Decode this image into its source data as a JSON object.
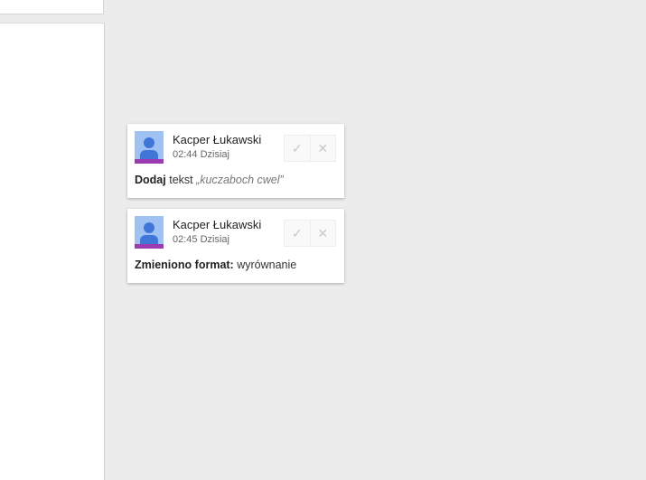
{
  "colors": {
    "canvas_background": "#ececec",
    "avatar_background": "#9fc2f3",
    "avatar_figure": "#3f76d8",
    "user_color": "#9c3ab2"
  },
  "suggestions": [
    {
      "author": "Kacper Łukawski",
      "time": "02:44 Dzisiaj",
      "action": "Dodaj",
      "detail": "tekst",
      "quoted_text": "„kuczaboch cwel”",
      "accept_icon": "checkmark-icon",
      "reject_icon": "close-icon"
    },
    {
      "author": "Kacper Łukawski",
      "time": "02:45 Dzisiaj",
      "action": "Zmieniono format:",
      "detail": "wyrównanie",
      "accept_icon": "checkmark-icon",
      "reject_icon": "close-icon"
    }
  ]
}
